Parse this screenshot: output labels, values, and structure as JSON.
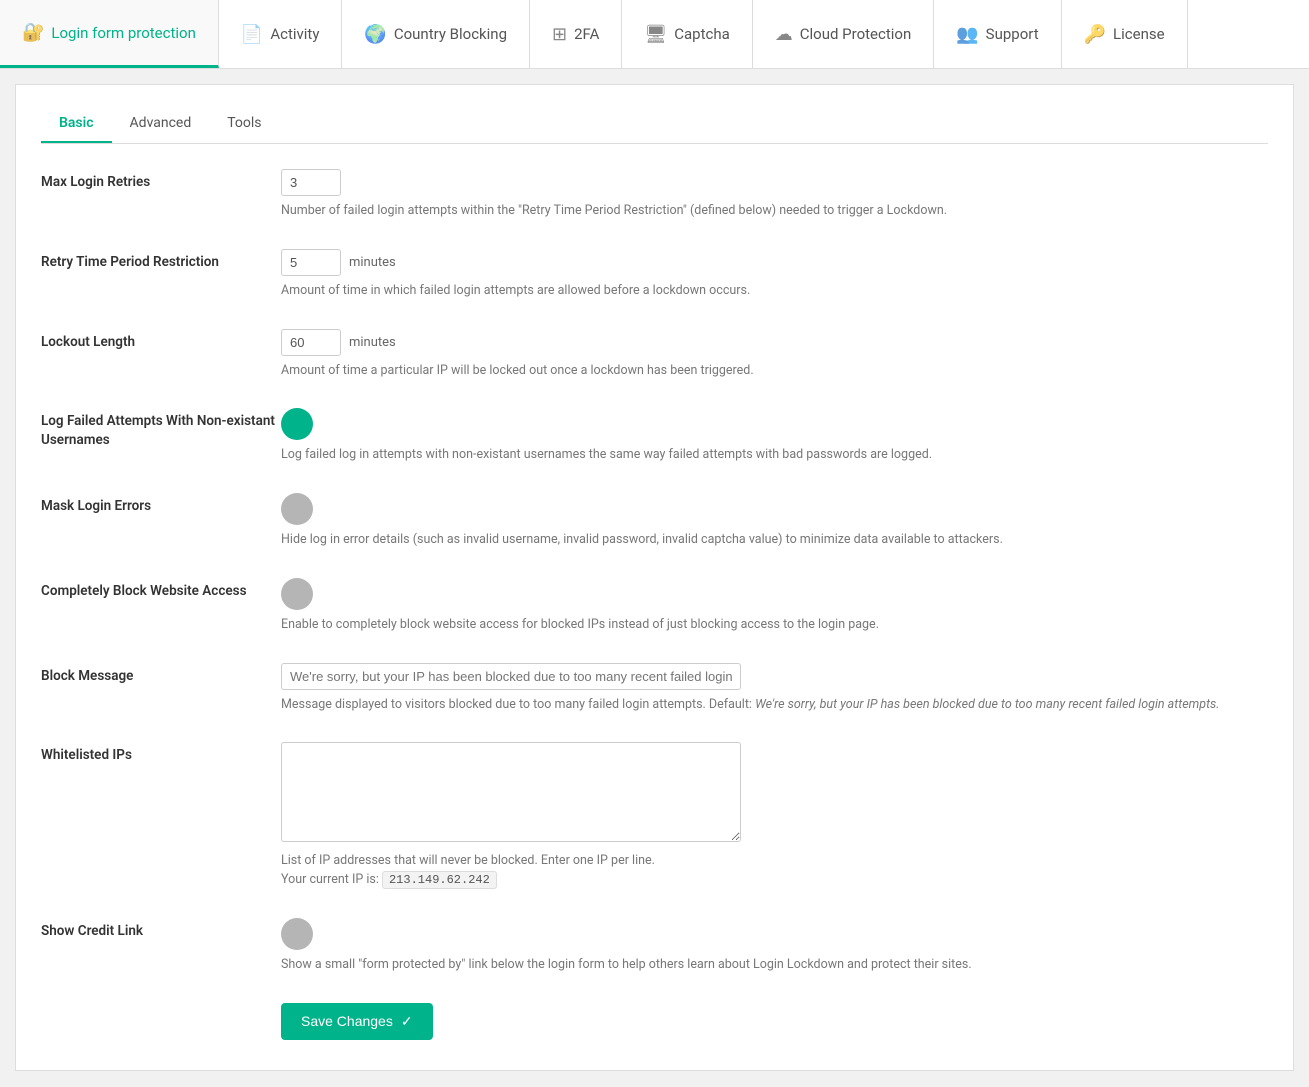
{
  "nav": {
    "items": [
      {
        "id": "login-form-protection",
        "label": "Login form protection",
        "icon": "🔐",
        "active": true
      },
      {
        "id": "activity",
        "label": "Activity",
        "icon": "📄",
        "active": false
      },
      {
        "id": "country-blocking",
        "label": "Country Blocking",
        "icon": "🌍",
        "active": false
      },
      {
        "id": "2fa",
        "label": "2FA",
        "icon": "⊞",
        "active": false
      },
      {
        "id": "captcha",
        "label": "Captcha",
        "icon": "🖥",
        "active": false
      },
      {
        "id": "cloud-protection",
        "label": "Cloud Protection",
        "icon": "☁",
        "active": false
      },
      {
        "id": "support",
        "label": "Support",
        "icon": "👥",
        "active": false
      },
      {
        "id": "license",
        "label": "License",
        "icon": "🔑",
        "active": false
      }
    ]
  },
  "sub_tabs": {
    "items": [
      {
        "id": "basic",
        "label": "Basic",
        "active": true
      },
      {
        "id": "advanced",
        "label": "Advanced",
        "active": false
      },
      {
        "id": "tools",
        "label": "Tools",
        "active": false
      }
    ]
  },
  "form": {
    "fields": {
      "max_login_retries": {
        "label": "Max Login Retries",
        "value": "3",
        "description": "Number of failed login attempts within the \"Retry Time Period Restriction\" (defined below) needed to trigger a Lockdown."
      },
      "retry_time_period": {
        "label": "Retry Time Period Restriction",
        "value": "5",
        "suffix": "minutes",
        "description": "Amount of time in which failed login attempts are allowed before a lockdown occurs."
      },
      "lockout_length": {
        "label": "Lockout Length",
        "value": "60",
        "suffix": "minutes",
        "description": "Amount of time a particular IP will be locked out once a lockdown has been triggered."
      },
      "log_failed_attempts": {
        "label": "Log Failed Attempts With Non-existant Usernames",
        "toggle_state": "on",
        "description": "Log failed log in attempts with non-existant usernames the same way failed attempts with bad passwords are logged."
      },
      "mask_login_errors": {
        "label": "Mask Login Errors",
        "toggle_state": "off",
        "description": "Hide log in error details (such as invalid username, invalid password, invalid captcha value) to minimize data available to attackers."
      },
      "completely_block": {
        "label": "Completely Block Website Access",
        "toggle_state": "off",
        "description": "Enable to completely block website access for blocked IPs instead of just blocking access to the login page."
      },
      "block_message": {
        "label": "Block Message",
        "placeholder": "We're sorry, but your IP has been blocked due to too many recent failed login attem",
        "description": "Message displayed to visitors blocked due to too many failed login attempts. Default: ",
        "default_italic": "We're sorry, but your IP has been blocked due to too many recent failed login attempts."
      },
      "whitelisted_ips": {
        "label": "Whitelisted IPs",
        "value": "",
        "description_line1": "List of IP addresses that will never be blocked. Enter one IP per line.",
        "description_line2": "Your current IP is: ",
        "current_ip": "213.149.62.242"
      },
      "show_credit_link": {
        "label": "Show Credit Link",
        "toggle_state": "off",
        "description": "Show a small \"form protected by\" link below the login form to help others learn about Login Lockdown and protect their sites."
      }
    },
    "save_button": "Save Changes"
  }
}
